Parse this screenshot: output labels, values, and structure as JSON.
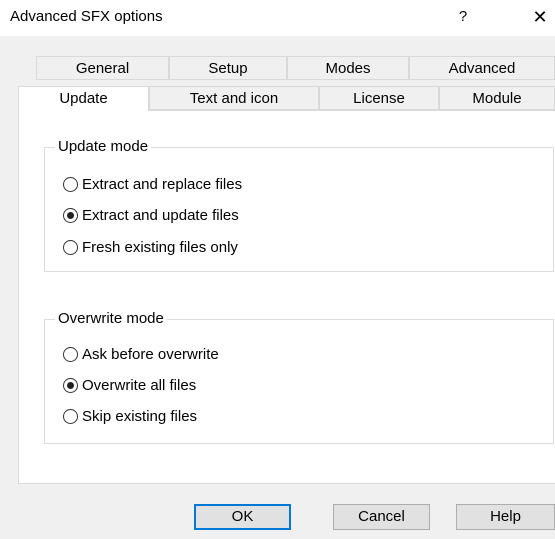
{
  "window": {
    "title": "Advanced SFX options",
    "help_label": "?",
    "close_label": "✕"
  },
  "tabs_row1": [
    "General",
    "Setup",
    "Modes",
    "Advanced"
  ],
  "tabs_row2": [
    "Update",
    "Text and icon",
    "License",
    "Module"
  ],
  "active_tab": "Update",
  "update_mode": {
    "label": "Update mode",
    "options": [
      "Extract and replace files",
      "Extract and update files",
      "Fresh existing files only"
    ],
    "selected": "Extract and update files"
  },
  "overwrite_mode": {
    "label": "Overwrite mode",
    "options": [
      "Ask before overwrite",
      "Overwrite all files",
      "Skip existing files"
    ],
    "selected": "Overwrite all files"
  },
  "buttons": {
    "ok": "OK",
    "cancel": "Cancel",
    "help": "Help"
  }
}
